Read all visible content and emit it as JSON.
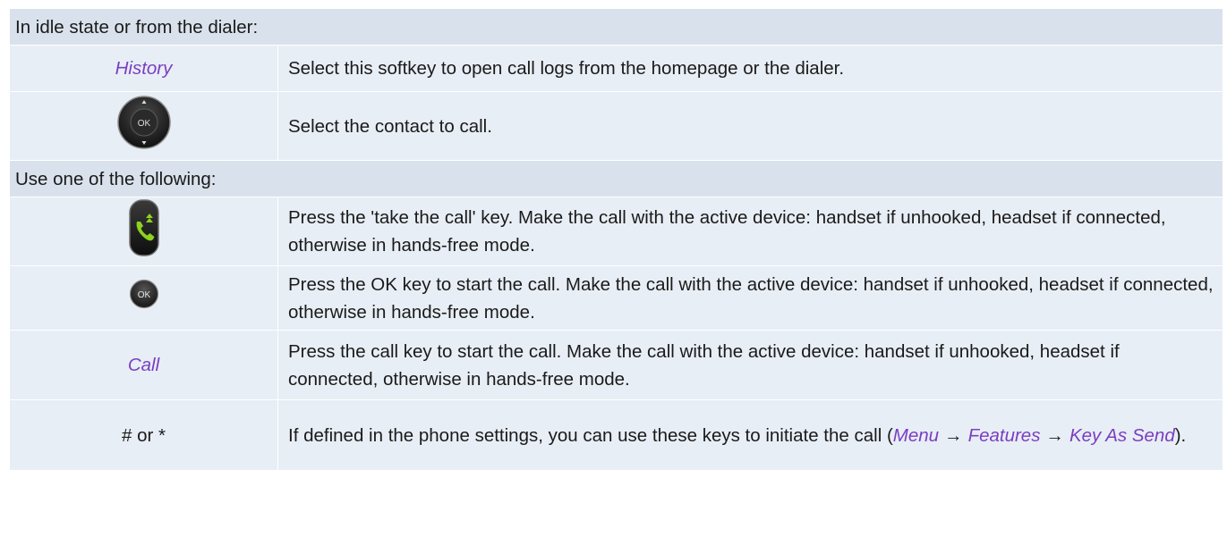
{
  "sections": {
    "idle_header": "In idle state or from the dialer:",
    "options_header": "Use one of the following:"
  },
  "rows": {
    "history": {
      "key_label": "History",
      "description": "Select this softkey to open call logs from the homepage or the dialer."
    },
    "navigator": {
      "icon": "navigator-ok-icon",
      "icon_label": "OK",
      "description": "Select the contact to call."
    },
    "take_call": {
      "icon": "take-call-key-icon",
      "description": "Press the 'take the call' key. Make the call with the active device: handset if unhooked, headset if connected, otherwise in hands-free mode."
    },
    "ok_key": {
      "icon": "ok-key-icon",
      "icon_label": "OK",
      "description": "Press the OK key to start the call. Make the call with the active device: handset if unhooked, headset if connected, otherwise in hands-free mode."
    },
    "call_softkey": {
      "key_label": "Call",
      "description": "Press the call key to start the call. Make the call with the active device: handset if unhooked, headset if connected, otherwise in hands-free mode."
    },
    "hash_star": {
      "key_label": "# or *",
      "description_prefix": "If defined in the phone settings, you can use these keys to initiate the call (",
      "menu_path": [
        "Menu",
        "Features",
        "Key As Send"
      ],
      "arrow": "→",
      "description_suffix": ")."
    }
  },
  "colors": {
    "softkey_text": "#7a3ec2",
    "row_background": "#e8eef5",
    "header_background": "#d9e2ec",
    "call_icon_green": "#8cd21e"
  }
}
